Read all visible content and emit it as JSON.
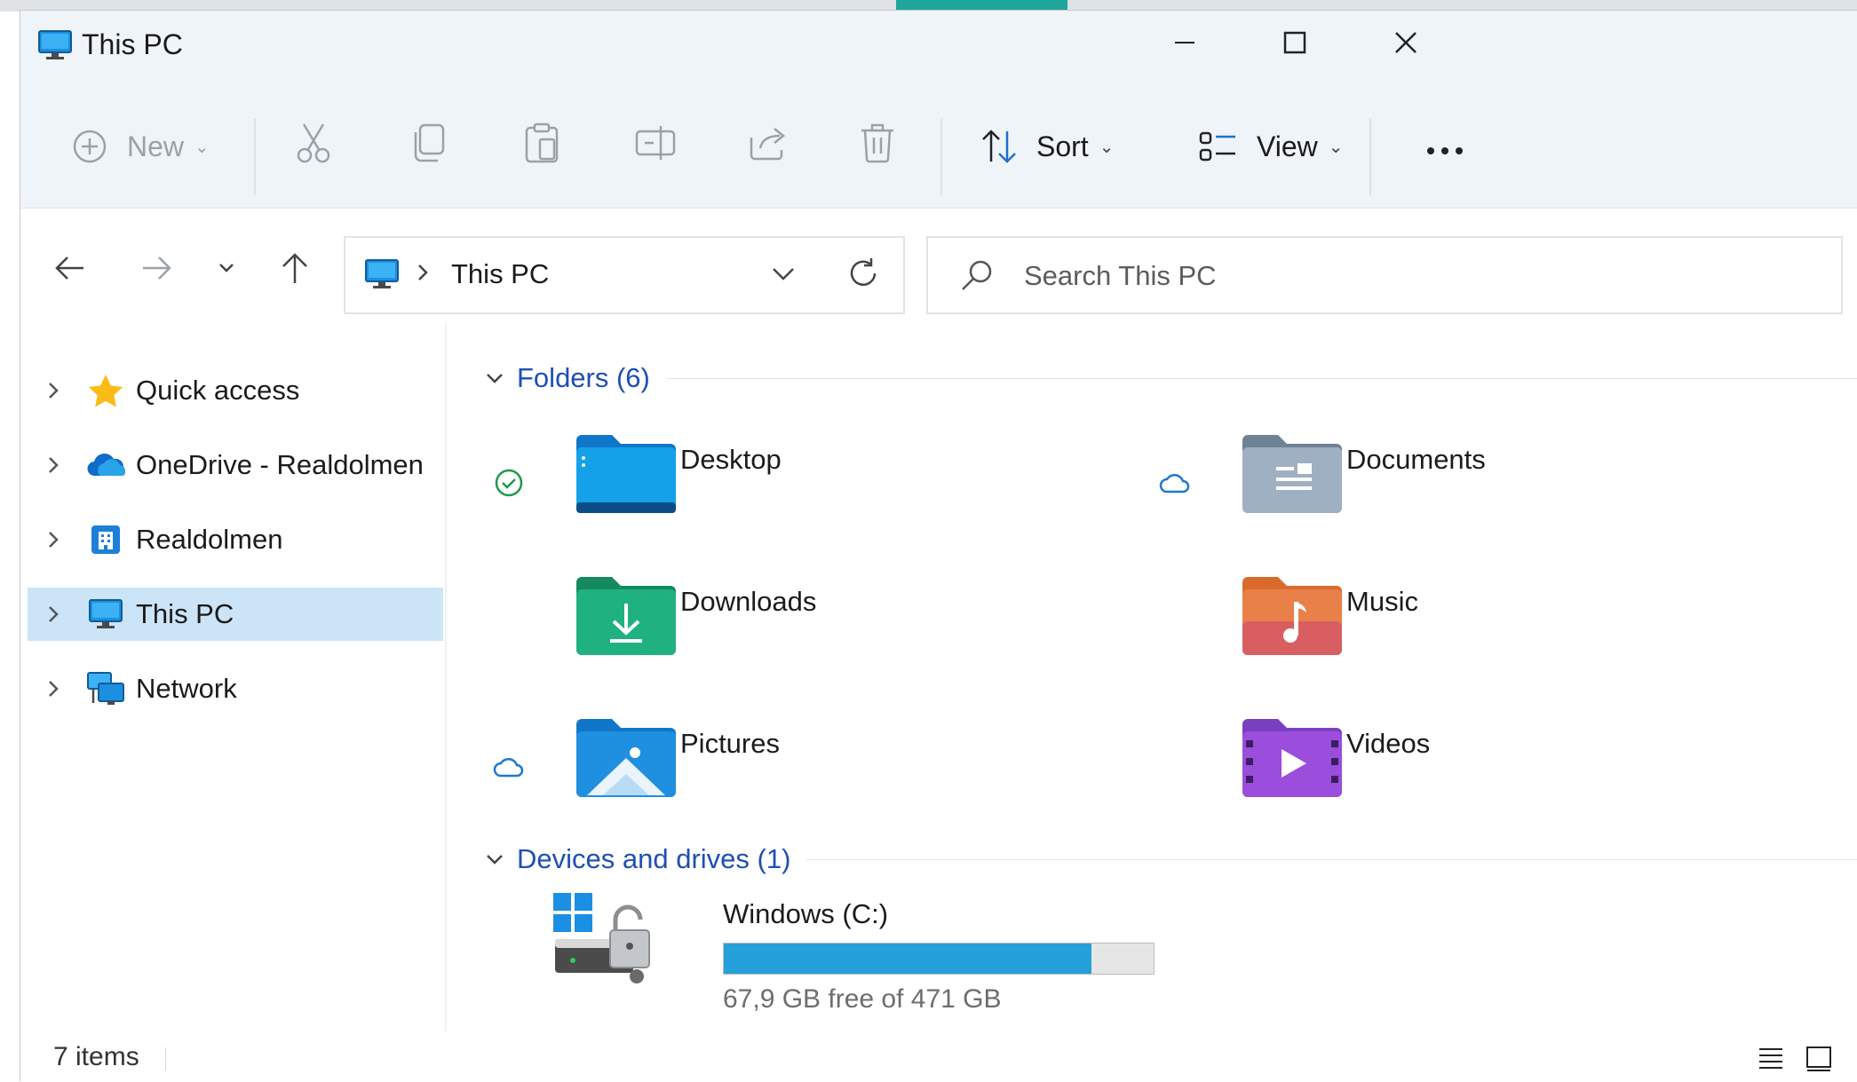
{
  "window": {
    "title": "This PC",
    "icon": "this-pc-icon"
  },
  "window_controls": {
    "minimize": "minimize-icon",
    "maximize": "maximize-icon",
    "close": "close-icon"
  },
  "toolbar": {
    "new_label": "New",
    "sort_label": "Sort",
    "view_label": "View",
    "icons": [
      "plus-circle-icon",
      "cut-icon",
      "copy-icon",
      "paste-icon",
      "rename-icon",
      "share-icon",
      "delete-icon",
      "sort-icon",
      "view-icon",
      "more-icon"
    ]
  },
  "address": {
    "path": "This PC"
  },
  "search": {
    "placeholder": "Search This PC"
  },
  "sidebar": {
    "items": [
      {
        "label": "Quick access",
        "icon": "star-icon"
      },
      {
        "label": "OneDrive - Realdolmen",
        "icon": "onedrive-cloud-icon"
      },
      {
        "label": "Realdolmen",
        "icon": "building-icon"
      },
      {
        "label": "This PC",
        "icon": "this-pc-icon",
        "selected": true
      },
      {
        "label": "Network",
        "icon": "network-icon"
      }
    ]
  },
  "folders": {
    "header": "Folders (6)",
    "items": [
      {
        "name": "Desktop",
        "status": "synced-check-icon",
        "icon": "desktop-folder-icon"
      },
      {
        "name": "Documents",
        "status": "cloud-icon",
        "icon": "documents-folder-icon"
      },
      {
        "name": "Downloads",
        "status": "",
        "icon": "downloads-folder-icon"
      },
      {
        "name": "Music",
        "status": "",
        "icon": "music-folder-icon"
      },
      {
        "name": "Pictures",
        "status": "cloud-icon",
        "icon": "pictures-folder-icon"
      },
      {
        "name": "Videos",
        "status": "",
        "icon": "videos-folder-icon"
      }
    ]
  },
  "drives": {
    "header": "Devices and drives (1)",
    "items": [
      {
        "name": "Windows (C:)",
        "free_text": "67,9 GB free of 471 GB",
        "used_fraction": 0.856,
        "bar_color": "#26a0da",
        "icon": "windows-drive-locked-icon"
      }
    ]
  },
  "status_bar": {
    "item_count": "7 items",
    "icons": [
      "details-view-icon",
      "tiles-view-icon"
    ]
  },
  "colors": {
    "accent": "#1e4fb5",
    "selection": "#cce4f7",
    "bar": "#26a0da"
  }
}
